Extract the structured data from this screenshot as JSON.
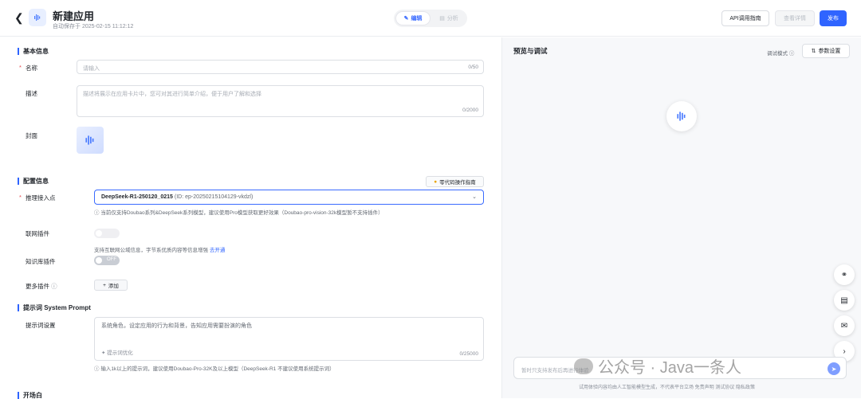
{
  "header": {
    "back_icon": "chevron-left-icon",
    "title": "新建应用",
    "autosave": "自动保存于 2025-02-15 11:12:12",
    "tab_edit": "编辑",
    "tab_analysis": "分析",
    "api_guide": "API调用指南",
    "view_detail": "查看详情",
    "publish": "发布"
  },
  "basic": {
    "section": "基本信息",
    "name_label": "名称",
    "name_placeholder": "请输入",
    "name_count": "0/50",
    "desc_label": "描述",
    "desc_placeholder": "描述将展示在应用卡片中，您可对其进行简单介绍，便于用户了解和选择",
    "desc_count": "0/2000",
    "cover_label": "封面"
  },
  "config": {
    "section": "配置信息",
    "guide_button": "零代码操作指南",
    "endpoint_label": "推理接入点",
    "endpoint_model": "DeepSeek-R1-250120_0215",
    "endpoint_id": "(ID: ep-20250215104129-vkdzl)",
    "endpoint_hint": "当前仅支持Doubao系列&DeepSeek系列模型，建议使用Pro模型获取更好效果（Doubao-pro-vision-32k模型暂不支持插件）",
    "web_plugin_label": "联网插件",
    "web_plugin_hint": "支持互联网公域信息，字节系优质内容等信息增强",
    "web_plugin_link": "去开通",
    "kb_plugin_label": "知识库插件",
    "kb_toggle_text": "OFF",
    "more_plugins_label": "更多插件",
    "add_button": "添加"
  },
  "prompt": {
    "section": "提示词 System Prompt",
    "label": "提示词设置",
    "placeholder": "系统角色，设定应用的行为和背景，告知应用需要扮演的角色",
    "optimize": "提示词优化",
    "count": "0/25000",
    "hint": "输入1k以上的提示词，建议使用Doubao-Pro-32K及以上模型（DeepSeek-R1 不建议使用系统提示词）"
  },
  "next_section": "开场白",
  "preview": {
    "title": "预览与调试",
    "debug_mode": "调试模式",
    "param_settings": "参数设置",
    "input_placeholder": "暂时只支持发布后再进行体验",
    "disclaimer": "试用体验内容均由人工智能模型生成，不代表平台立场    免责声明  测试协议  隐私政策"
  },
  "watermark": "公众号 · Java一条人",
  "colors": {
    "accent": "#2f64ff",
    "required": "#e5484d"
  }
}
